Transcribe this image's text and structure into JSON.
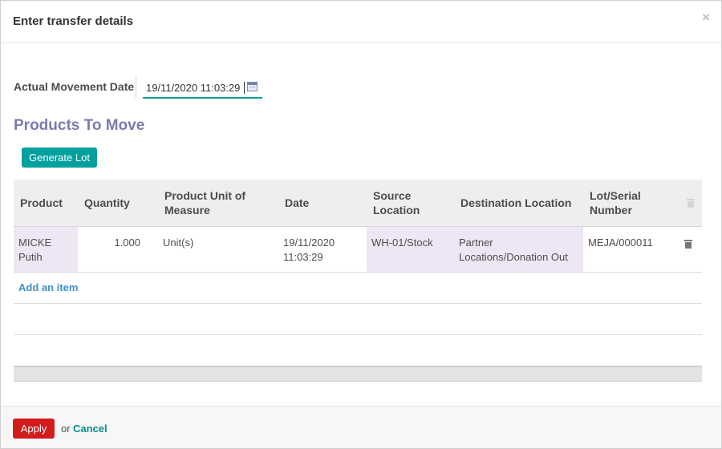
{
  "dialog": {
    "title": "Enter transfer details",
    "close_label": "×"
  },
  "form": {
    "date_label": "Actual Movement Date",
    "date_value": "19/11/2020 11:03:29"
  },
  "section_title": "Products To Move",
  "generate_lot_label": "Generate Lot",
  "table": {
    "columns": {
      "product": "Product",
      "quantity": "Quantity",
      "uom": "Product Unit of Measure",
      "date": "Date",
      "source": "Source Location",
      "destination": "Destination Location",
      "lot": "Lot/Serial Number"
    },
    "rows": [
      {
        "product": "MICKE Putih",
        "quantity": "1.000",
        "uom": "Unit(s)",
        "date": "19/11/2020 11:03:29",
        "source": "WH-01/Stock",
        "destination": "Partner Locations/Donation Out",
        "lot": "MEJA/000011"
      }
    ],
    "add_item_label": "Add an item"
  },
  "footer": {
    "apply_label": "Apply",
    "or_text": "or",
    "cancel_label": "Cancel"
  },
  "colors": {
    "primary": "#00a09d",
    "section_title": "#7c7bad",
    "danger": "#d31b1b",
    "link": "#3f8ec6",
    "readonly_cell": "#ede6f4"
  }
}
